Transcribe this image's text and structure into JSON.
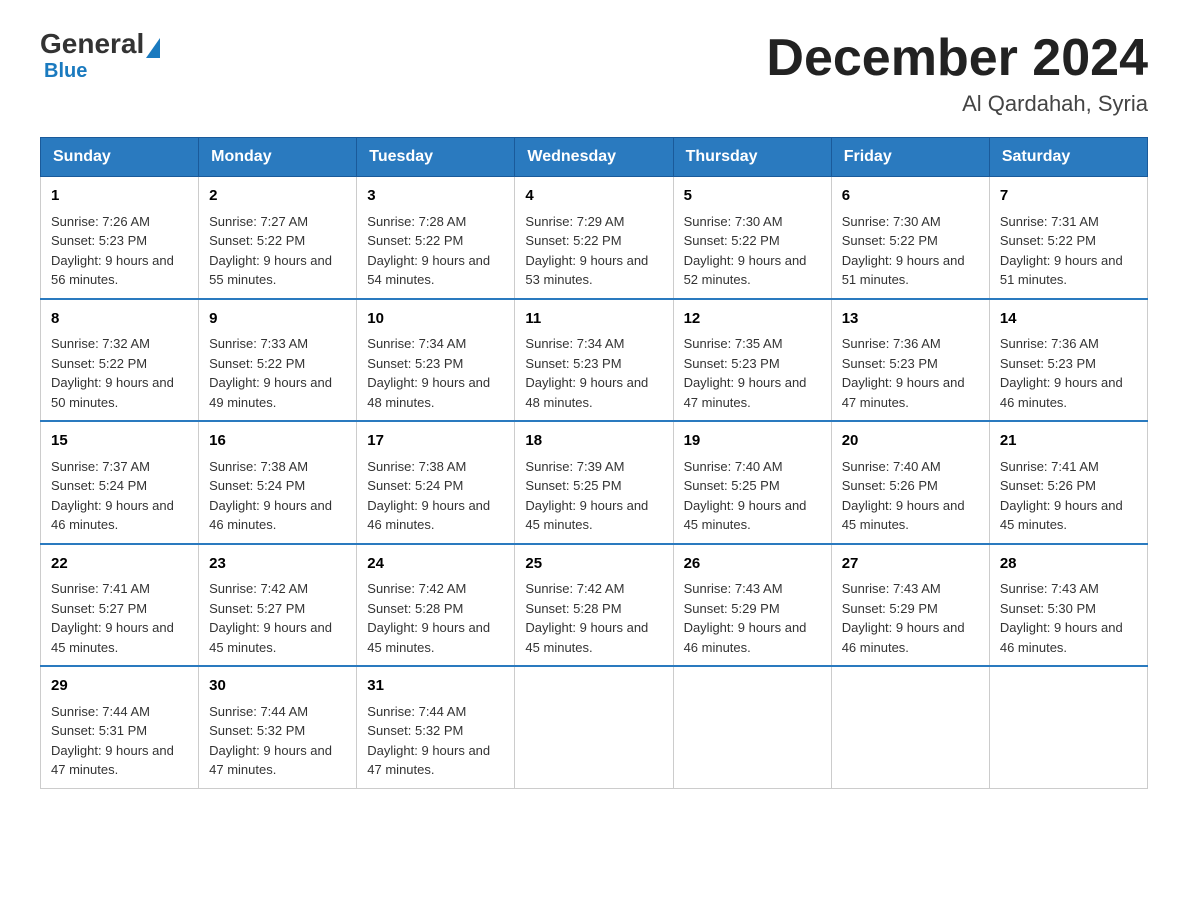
{
  "logo": {
    "general": "General",
    "blue": "Blue"
  },
  "title": "December 2024",
  "location": "Al Qardahah, Syria",
  "days_of_week": [
    "Sunday",
    "Monday",
    "Tuesday",
    "Wednesday",
    "Thursday",
    "Friday",
    "Saturday"
  ],
  "weeks": [
    [
      {
        "day": "1",
        "sunrise": "7:26 AM",
        "sunset": "5:23 PM",
        "daylight": "9 hours and 56 minutes."
      },
      {
        "day": "2",
        "sunrise": "7:27 AM",
        "sunset": "5:22 PM",
        "daylight": "9 hours and 55 minutes."
      },
      {
        "day": "3",
        "sunrise": "7:28 AM",
        "sunset": "5:22 PM",
        "daylight": "9 hours and 54 minutes."
      },
      {
        "day": "4",
        "sunrise": "7:29 AM",
        "sunset": "5:22 PM",
        "daylight": "9 hours and 53 minutes."
      },
      {
        "day": "5",
        "sunrise": "7:30 AM",
        "sunset": "5:22 PM",
        "daylight": "9 hours and 52 minutes."
      },
      {
        "day": "6",
        "sunrise": "7:30 AM",
        "sunset": "5:22 PM",
        "daylight": "9 hours and 51 minutes."
      },
      {
        "day": "7",
        "sunrise": "7:31 AM",
        "sunset": "5:22 PM",
        "daylight": "9 hours and 51 minutes."
      }
    ],
    [
      {
        "day": "8",
        "sunrise": "7:32 AM",
        "sunset": "5:22 PM",
        "daylight": "9 hours and 50 minutes."
      },
      {
        "day": "9",
        "sunrise": "7:33 AM",
        "sunset": "5:22 PM",
        "daylight": "9 hours and 49 minutes."
      },
      {
        "day": "10",
        "sunrise": "7:34 AM",
        "sunset": "5:23 PM",
        "daylight": "9 hours and 48 minutes."
      },
      {
        "day": "11",
        "sunrise": "7:34 AM",
        "sunset": "5:23 PM",
        "daylight": "9 hours and 48 minutes."
      },
      {
        "day": "12",
        "sunrise": "7:35 AM",
        "sunset": "5:23 PM",
        "daylight": "9 hours and 47 minutes."
      },
      {
        "day": "13",
        "sunrise": "7:36 AM",
        "sunset": "5:23 PM",
        "daylight": "9 hours and 47 minutes."
      },
      {
        "day": "14",
        "sunrise": "7:36 AM",
        "sunset": "5:23 PM",
        "daylight": "9 hours and 46 minutes."
      }
    ],
    [
      {
        "day": "15",
        "sunrise": "7:37 AM",
        "sunset": "5:24 PM",
        "daylight": "9 hours and 46 minutes."
      },
      {
        "day": "16",
        "sunrise": "7:38 AM",
        "sunset": "5:24 PM",
        "daylight": "9 hours and 46 minutes."
      },
      {
        "day": "17",
        "sunrise": "7:38 AM",
        "sunset": "5:24 PM",
        "daylight": "9 hours and 46 minutes."
      },
      {
        "day": "18",
        "sunrise": "7:39 AM",
        "sunset": "5:25 PM",
        "daylight": "9 hours and 45 minutes."
      },
      {
        "day": "19",
        "sunrise": "7:40 AM",
        "sunset": "5:25 PM",
        "daylight": "9 hours and 45 minutes."
      },
      {
        "day": "20",
        "sunrise": "7:40 AM",
        "sunset": "5:26 PM",
        "daylight": "9 hours and 45 minutes."
      },
      {
        "day": "21",
        "sunrise": "7:41 AM",
        "sunset": "5:26 PM",
        "daylight": "9 hours and 45 minutes."
      }
    ],
    [
      {
        "day": "22",
        "sunrise": "7:41 AM",
        "sunset": "5:27 PM",
        "daylight": "9 hours and 45 minutes."
      },
      {
        "day": "23",
        "sunrise": "7:42 AM",
        "sunset": "5:27 PM",
        "daylight": "9 hours and 45 minutes."
      },
      {
        "day": "24",
        "sunrise": "7:42 AM",
        "sunset": "5:28 PM",
        "daylight": "9 hours and 45 minutes."
      },
      {
        "day": "25",
        "sunrise": "7:42 AM",
        "sunset": "5:28 PM",
        "daylight": "9 hours and 45 minutes."
      },
      {
        "day": "26",
        "sunrise": "7:43 AM",
        "sunset": "5:29 PM",
        "daylight": "9 hours and 46 minutes."
      },
      {
        "day": "27",
        "sunrise": "7:43 AM",
        "sunset": "5:29 PM",
        "daylight": "9 hours and 46 minutes."
      },
      {
        "day": "28",
        "sunrise": "7:43 AM",
        "sunset": "5:30 PM",
        "daylight": "9 hours and 46 minutes."
      }
    ],
    [
      {
        "day": "29",
        "sunrise": "7:44 AM",
        "sunset": "5:31 PM",
        "daylight": "9 hours and 47 minutes."
      },
      {
        "day": "30",
        "sunrise": "7:44 AM",
        "sunset": "5:32 PM",
        "daylight": "9 hours and 47 minutes."
      },
      {
        "day": "31",
        "sunrise": "7:44 AM",
        "sunset": "5:32 PM",
        "daylight": "9 hours and 47 minutes."
      },
      null,
      null,
      null,
      null
    ]
  ]
}
